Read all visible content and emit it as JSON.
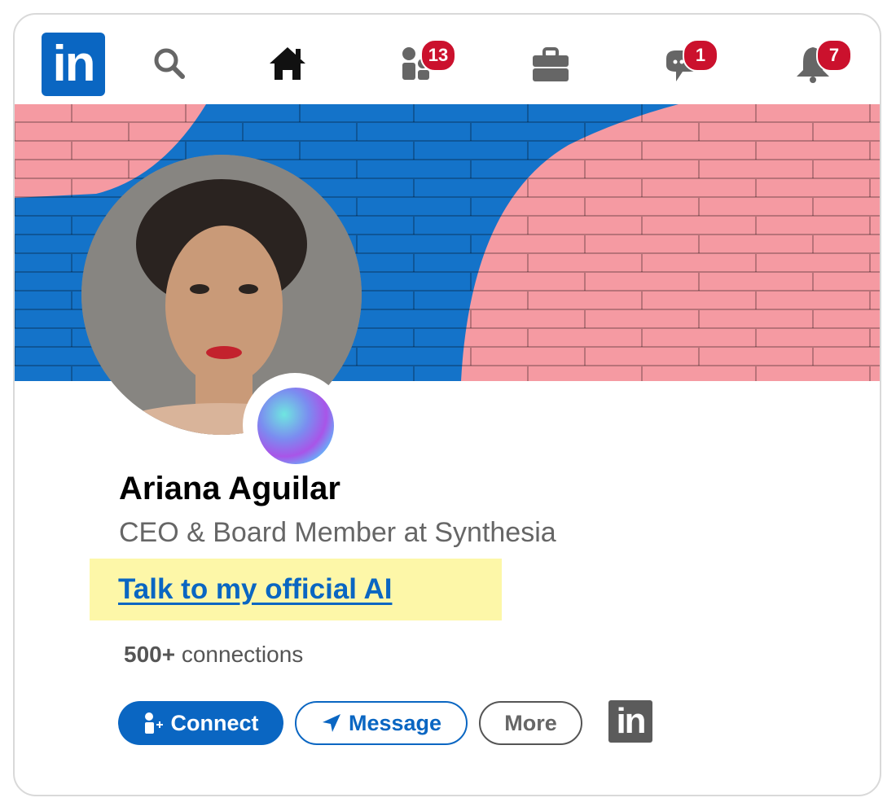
{
  "nav": {
    "logo_text": "in",
    "items": [
      {
        "icon": "search-icon",
        "badge": null
      },
      {
        "icon": "home-icon",
        "badge": null
      },
      {
        "icon": "my-network-icon",
        "badge": "13"
      },
      {
        "icon": "jobs-briefcase-icon",
        "badge": null
      },
      {
        "icon": "messaging-icon",
        "badge": "1"
      },
      {
        "icon": "notifications-bell-icon",
        "badge": "7"
      }
    ]
  },
  "colors": {
    "brand": "#0a66c2",
    "badge": "#cb112d",
    "banner_blue": "#1473c9",
    "banner_pink": "#f59aa2",
    "highlight": "#fdf7a8"
  },
  "profile": {
    "name": "Ariana Aguilar",
    "headline": "CEO & Board Member at Synthesia",
    "ai_link": "Talk to my official AI",
    "connections_count": "500+",
    "connections_label": " connections"
  },
  "actions": {
    "connect": "Connect",
    "message": "Message",
    "more": "More",
    "linkedin_mini": "in"
  }
}
